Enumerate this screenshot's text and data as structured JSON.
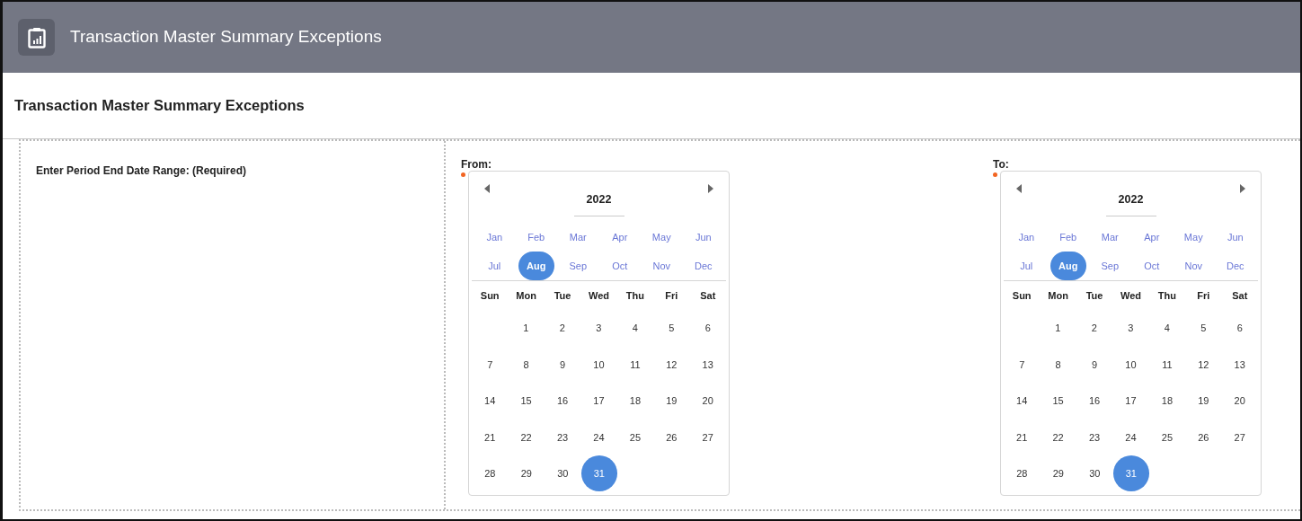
{
  "app_bar": {
    "title": "Transaction Master Summary Exceptions"
  },
  "page_title": "Transaction Master Summary Exceptions",
  "prompt": "Enter Period End Date Range: (Required)",
  "calendars": [
    {
      "label": "From:",
      "required": true,
      "year": "2022",
      "months": [
        {
          "label": "Jan",
          "selected": false
        },
        {
          "label": "Feb",
          "selected": false
        },
        {
          "label": "Mar",
          "selected": false
        },
        {
          "label": "Apr",
          "selected": false
        },
        {
          "label": "May",
          "selected": false
        },
        {
          "label": "Jun",
          "selected": false
        },
        {
          "label": "Jul",
          "selected": false
        },
        {
          "label": "Aug",
          "selected": true
        },
        {
          "label": "Sep",
          "selected": false
        },
        {
          "label": "Oct",
          "selected": false
        },
        {
          "label": "Nov",
          "selected": false
        },
        {
          "label": "Dec",
          "selected": false
        }
      ],
      "weekdays": [
        "Sun",
        "Mon",
        "Tue",
        "Wed",
        "Thu",
        "Fri",
        "Sat"
      ],
      "weeks": [
        {
          "kind": "leading",
          "days": [
            {
              "label": "1",
              "selected": false
            },
            {
              "label": "2",
              "selected": false
            },
            {
              "label": "3",
              "selected": false
            },
            {
              "label": "4",
              "selected": false
            },
            {
              "label": "5",
              "selected": false
            },
            {
              "label": "6",
              "selected": false
            }
          ]
        },
        {
          "kind": "full",
          "days": [
            {
              "label": "7",
              "selected": false
            },
            {
              "label": "8",
              "selected": false
            },
            {
              "label": "9",
              "selected": false
            },
            {
              "label": "10",
              "selected": false
            },
            {
              "label": "11",
              "selected": false
            },
            {
              "label": "12",
              "selected": false
            },
            {
              "label": "13",
              "selected": false
            }
          ]
        },
        {
          "kind": "full",
          "days": [
            {
              "label": "14",
              "selected": false
            },
            {
              "label": "15",
              "selected": false
            },
            {
              "label": "16",
              "selected": false
            },
            {
              "label": "17",
              "selected": false
            },
            {
              "label": "18",
              "selected": false
            },
            {
              "label": "19",
              "selected": false
            },
            {
              "label": "20",
              "selected": false
            }
          ]
        },
        {
          "kind": "full",
          "days": [
            {
              "label": "21",
              "selected": false
            },
            {
              "label": "22",
              "selected": false
            },
            {
              "label": "23",
              "selected": false
            },
            {
              "label": "24",
              "selected": false
            },
            {
              "label": "25",
              "selected": false
            },
            {
              "label": "26",
              "selected": false
            },
            {
              "label": "27",
              "selected": false
            }
          ]
        },
        {
          "kind": "trailing",
          "days": [
            {
              "label": "28",
              "selected": false
            },
            {
              "label": "29",
              "selected": false
            },
            {
              "label": "30",
              "selected": false
            },
            {
              "label": "31",
              "selected": true
            }
          ]
        }
      ]
    },
    {
      "label": "To:",
      "required": true,
      "year": "2022",
      "months": [
        {
          "label": "Jan",
          "selected": false
        },
        {
          "label": "Feb",
          "selected": false
        },
        {
          "label": "Mar",
          "selected": false
        },
        {
          "label": "Apr",
          "selected": false
        },
        {
          "label": "May",
          "selected": false
        },
        {
          "label": "Jun",
          "selected": false
        },
        {
          "label": "Jul",
          "selected": false
        },
        {
          "label": "Aug",
          "selected": true
        },
        {
          "label": "Sep",
          "selected": false
        },
        {
          "label": "Oct",
          "selected": false
        },
        {
          "label": "Nov",
          "selected": false
        },
        {
          "label": "Dec",
          "selected": false
        }
      ],
      "weekdays": [
        "Sun",
        "Mon",
        "Tue",
        "Wed",
        "Thu",
        "Fri",
        "Sat"
      ],
      "weeks": [
        {
          "kind": "leading",
          "days": [
            {
              "label": "1",
              "selected": false
            },
            {
              "label": "2",
              "selected": false
            },
            {
              "label": "3",
              "selected": false
            },
            {
              "label": "4",
              "selected": false
            },
            {
              "label": "5",
              "selected": false
            },
            {
              "label": "6",
              "selected": false
            }
          ]
        },
        {
          "kind": "full",
          "days": [
            {
              "label": "7",
              "selected": false
            },
            {
              "label": "8",
              "selected": false
            },
            {
              "label": "9",
              "selected": false
            },
            {
              "label": "10",
              "selected": false
            },
            {
              "label": "11",
              "selected": false
            },
            {
              "label": "12",
              "selected": false
            },
            {
              "label": "13",
              "selected": false
            }
          ]
        },
        {
          "kind": "full",
          "days": [
            {
              "label": "14",
              "selected": false
            },
            {
              "label": "15",
              "selected": false
            },
            {
              "label": "16",
              "selected": false
            },
            {
              "label": "17",
              "selected": false
            },
            {
              "label": "18",
              "selected": false
            },
            {
              "label": "19",
              "selected": false
            },
            {
              "label": "20",
              "selected": false
            }
          ]
        },
        {
          "kind": "full",
          "days": [
            {
              "label": "21",
              "selected": false
            },
            {
              "label": "22",
              "selected": false
            },
            {
              "label": "23",
              "selected": false
            },
            {
              "label": "24",
              "selected": false
            },
            {
              "label": "25",
              "selected": false
            },
            {
              "label": "26",
              "selected": false
            },
            {
              "label": "27",
              "selected": false
            }
          ]
        },
        {
          "kind": "trailing",
          "days": [
            {
              "label": "28",
              "selected": false
            },
            {
              "label": "29",
              "selected": false
            },
            {
              "label": "30",
              "selected": false
            },
            {
              "label": "31",
              "selected": true
            }
          ]
        }
      ]
    }
  ]
}
